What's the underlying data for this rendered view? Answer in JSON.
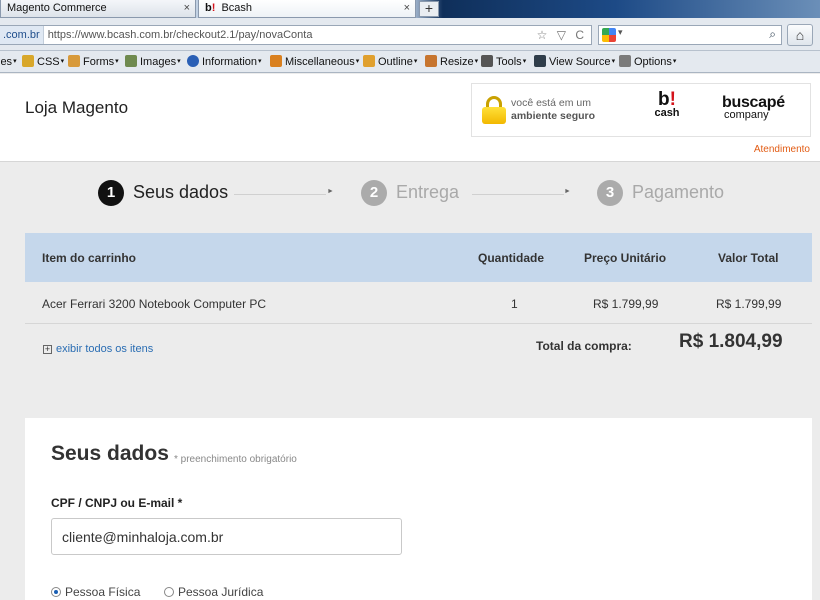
{
  "browser": {
    "tabs": [
      {
        "label": "Magento Commerce",
        "close": "×"
      },
      {
        "label": "Bcash",
        "close": "×",
        "favicon_text": "b",
        "favicon_mark": "!"
      }
    ],
    "new_tab": "+",
    "url_host": ".com.br",
    "url_path": "https://www.bcash.com.br/checkout2.1/pay/novaConta",
    "url_controls": "☆ ▽ C",
    "search_dropdown": "▾",
    "search_icon": "⌕",
    "home_icon": "⌂"
  },
  "devtoolbar": {
    "items": [
      {
        "label": "ies",
        "icon": "none"
      },
      {
        "label": "CSS",
        "icon": "pencil-icon",
        "color": "#d8a72a"
      },
      {
        "label": "Forms",
        "icon": "clipboard-icon",
        "color": "#d89a3b"
      },
      {
        "label": "Images",
        "icon": "image-icon",
        "color": "#6f8a4f"
      },
      {
        "label": "Information",
        "icon": "info-icon",
        "color": "#2a5fb5"
      },
      {
        "label": "Miscellaneous",
        "icon": "folder-icon",
        "color": "#d9801f"
      },
      {
        "label": "Outline",
        "icon": "pencil-icon",
        "color": "#e0a02e"
      },
      {
        "label": "Resize",
        "icon": "pencil-icon",
        "color": "#c7752f"
      },
      {
        "label": "Tools",
        "icon": "scissors-icon",
        "color": "#555555"
      },
      {
        "label": "View Source",
        "icon": "monitor-icon",
        "color": "#2f3d4a"
      },
      {
        "label": "Options",
        "icon": "document-icon",
        "color": "#7b7b7b"
      }
    ]
  },
  "header": {
    "store_name": "Loja Magento",
    "secure_line1": "você está em um",
    "secure_line2": "ambiente seguro",
    "bcash_logo_b": "b",
    "bcash_logo_mark": "!",
    "bcash_logo_sub": "cash",
    "buscape_logo": "buscapé",
    "buscape_sub": "company",
    "support_link": "Atendimento"
  },
  "steps": [
    {
      "num": "1",
      "label": "Seus dados",
      "active": true
    },
    {
      "num": "2",
      "label": "Entrega",
      "active": false
    },
    {
      "num": "3",
      "label": "Pagamento",
      "active": false
    }
  ],
  "step_arrow": "►",
  "cart": {
    "headers": {
      "item": "Item do carrinho",
      "qty": "Quantidade",
      "unit": "Preço Unitário",
      "total": "Valor Total"
    },
    "rows": [
      {
        "item": "Acer Ferrari 3200 Notebook Computer PC",
        "qty": "1",
        "unit": "R$ 1.799,99",
        "total": "R$ 1.799,99"
      }
    ],
    "show_all": "exibir todos os itens",
    "show_all_icon": "+",
    "total_label": "Total da compra:",
    "total_value": "R$ 1.804,99"
  },
  "form": {
    "title": "Seus dados",
    "required_note": "* preenchimento obrigatório",
    "field_label": "CPF / CNPJ ou E-mail *",
    "field_value": "cliente@minhaloja.com.br",
    "radio_pf": "Pessoa Física",
    "radio_pj": "Pessoa Jurídica",
    "selected": "pf"
  }
}
